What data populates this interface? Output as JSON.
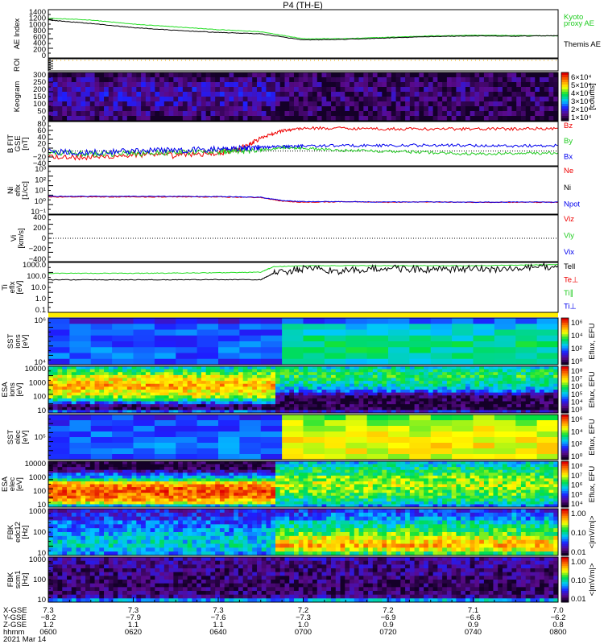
{
  "chart_data": {
    "type": "multi-panel",
    "title": "P4 (TH-E)",
    "x_unit": "minutes after 0600 UT",
    "xlim": [
      0,
      120
    ],
    "panels": [
      {
        "id": "ae",
        "type": "line",
        "ylabel": [
          "AE Index"
        ],
        "ylim": [
          0,
          1400
        ],
        "ticks": [
          "1400",
          "1200",
          "1000",
          "800",
          "600",
          "400",
          "200",
          "0"
        ],
        "legend": [
          {
            "text": "Kyoto",
            "color": "#22cc22"
          },
          {
            "text": "proxy AE",
            "color": "#22cc22"
          },
          {
            "text": "Themis AE",
            "color": "#000000"
          }
        ],
        "series": [
          {
            "name": "Kyoto proxy AE",
            "color": "#22dd22",
            "x": [
              0,
              10,
              20,
              30,
              40,
              50,
              60,
              70,
              80,
              90,
              100,
              110,
              120
            ],
            "y": [
              1150,
              1100,
              980,
              900,
              820,
              760,
              560,
              560,
              600,
              640,
              660,
              650,
              640
            ]
          },
          {
            "name": "Themis AE",
            "color": "#000000",
            "x": [
              0,
              10,
              20,
              30,
              40,
              50,
              60,
              70,
              80,
              90,
              100,
              110,
              120
            ],
            "y": [
              1100,
              1000,
              880,
              800,
              740,
              700,
              520,
              540,
              580,
              620,
              640,
              630,
              650
            ]
          }
        ]
      },
      {
        "id": "roi",
        "type": "line",
        "ylabel": [
          "ROI"
        ],
        "ticks": [],
        "legend": []
      },
      {
        "id": "keo",
        "type": "heatmap",
        "ylabel": [
          "Keogram"
        ],
        "ticks": [
          "300",
          "250",
          "200",
          "150",
          "100",
          "50",
          "0"
        ],
        "colorbar": {
          "labels": [
            "6×10⁴",
            "5×10⁴",
            "4×10⁴",
            "3×10⁴",
            "2×10⁴",
            "1×10⁴"
          ],
          "unit": "[counts]"
        },
        "rows": 10,
        "pre": [
          0.05,
          0.1,
          0.14,
          0.16,
          0.16,
          0.15,
          0.14,
          0.12,
          0.1,
          0.06
        ],
        "post": [
          0.03,
          0.06,
          0.08,
          0.08,
          0.08,
          0.08,
          0.07,
          0.06,
          0.05,
          0.03
        ]
      },
      {
        "id": "b",
        "type": "line",
        "ylabel": [
          "B FIT",
          "GSE",
          "[nT]"
        ],
        "ylim": [
          -40,
          80
        ],
        "ticks": [
          "80",
          "60",
          "40",
          "20",
          "0",
          "−20",
          "−40"
        ],
        "legend": [
          {
            "text": "Bz",
            "color": "#ee0000"
          },
          {
            "text": "By",
            "color": "#22cc22"
          },
          {
            "text": "Bx",
            "color": "#0000ee"
          }
        ],
        "series": [
          {
            "name": "Bz",
            "color": "#ee0000",
            "x": [
              0,
              10,
              20,
              30,
              40,
              45,
              50,
              55,
              60,
              70,
              80,
              90,
              100,
              110,
              120
            ],
            "y": [
              -15,
              -18,
              -10,
              -12,
              -5,
              5,
              35,
              55,
              62,
              62,
              60,
              60,
              60,
              60,
              62
            ]
          },
          {
            "name": "By",
            "color": "#22cc22",
            "x": [
              0,
              10,
              20,
              30,
              40,
              45,
              50,
              55,
              60,
              70,
              80,
              90,
              100,
              110,
              120
            ],
            "y": [
              -5,
              -8,
              -6,
              -3,
              -2,
              0,
              2,
              10,
              8,
              2,
              0,
              -4,
              -8,
              -6,
              -5
            ]
          },
          {
            "name": "Bx",
            "color": "#0000ee",
            "x": [
              0,
              10,
              20,
              30,
              40,
              45,
              50,
              55,
              60,
              70,
              80,
              90,
              100,
              110,
              120
            ],
            "y": [
              -2,
              -3,
              0,
              2,
              5,
              8,
              10,
              12,
              14,
              15,
              15,
              16,
              15,
              14,
              15
            ]
          }
        ]
      },
      {
        "id": "ni",
        "type": "line",
        "ylabel": [
          "Ni",
          "eflx",
          "[1/cc]"
        ],
        "ylim": [
          -1,
          3
        ],
        "log": true,
        "ticks": [
          "10³",
          "10²",
          "10¹",
          "10⁰",
          "10⁻¹"
        ],
        "legend": [
          {
            "text": "Ne",
            "color": "#ee0000"
          },
          {
            "text": "Ni",
            "color": "#000000"
          },
          {
            "text": "Npot",
            "color": "#0000ee"
          }
        ],
        "series": [
          {
            "name": "Ne",
            "color": "#ee0000",
            "x": [
              0,
              10,
              20,
              30,
              40,
              50,
              55,
              60,
              70,
              80,
              90,
              100,
              110,
              120
            ],
            "y": [
              0.45,
              0.45,
              0.45,
              0.45,
              0.45,
              0.4,
              0.1,
              0.0,
              0.05,
              0.0,
              0.02,
              0.0,
              0.0,
              0.0
            ]
          },
          {
            "name": "Npot",
            "color": "#0000ee",
            "x": [
              0,
              10,
              20,
              30,
              40,
              50,
              55,
              60,
              70,
              80,
              90,
              100,
              110,
              120
            ],
            "y": [
              0.5,
              0.5,
              0.5,
              0.5,
              0.48,
              0.42,
              0.15,
              0.05,
              0.05,
              0.02,
              0.03,
              0.0,
              0.02,
              0.02
            ]
          }
        ]
      },
      {
        "id": "vi",
        "type": "line",
        "ylabel": [
          "Vi",
          "[km/s]"
        ],
        "ylim": [
          -500,
          500
        ],
        "ticks": [
          "400",
          "200",
          "0",
          "−200",
          "−400"
        ],
        "legend": [
          {
            "text": "Viz",
            "color": "#ee0000"
          },
          {
            "text": "Viy",
            "color": "#22cc22"
          },
          {
            "text": "Vix",
            "color": "#0000ee"
          }
        ],
        "series": []
      },
      {
        "id": "ti",
        "type": "line",
        "ylabel": [
          "Ti",
          "eflx",
          "[eV]"
        ],
        "ylim": [
          -1,
          3.6
        ],
        "log": true,
        "ticks": [
          "1000.0",
          "100.0",
          "10.0",
          "1.0",
          "0.1"
        ],
        "legend": [
          {
            "text": "Tell",
            "color": "#000000"
          },
          {
            "text": "Te⊥",
            "color": "#ee0000"
          },
          {
            "text": "Ti∥",
            "color": "#22cc22"
          },
          {
            "text": "Ti⊥",
            "color": "#0000ee"
          }
        ],
        "series": [
          {
            "name": "Ti∥",
            "color": "#22dd22",
            "x": [
              0,
              10,
              20,
              30,
              40,
              50,
              53,
              60,
              70,
              80,
              90,
              100,
              110,
              120
            ],
            "y": [
              2.6,
              2.6,
              2.6,
              2.62,
              2.65,
              2.7,
              3.2,
              3.3,
              3.3,
              3.3,
              3.3,
              3.3,
              3.35,
              3.4
            ]
          },
          {
            "name": "Tell",
            "color": "#000000",
            "x": [
              0,
              10,
              20,
              30,
              40,
              50,
              53,
              60,
              70,
              80,
              90,
              100,
              110,
              120
            ],
            "y": [
              2.0,
              2.0,
              2.0,
              2.0,
              2.02,
              2.0,
              2.6,
              3.0,
              2.8,
              3.1,
              2.9,
              3.0,
              3.0,
              3.3
            ]
          }
        ]
      },
      {
        "id": "ssti",
        "type": "heatmap",
        "ylabel": [
          "SST",
          "ions",
          "[eV]"
        ],
        "ticks": [
          "10⁶",
          "10⁴"
        ],
        "colorbar": {
          "labels": [
            "10⁶",
            "10⁴",
            "10²",
            "10⁰"
          ],
          "unit": "Eflux, EFU"
        },
        "rows": 8,
        "pre": [
          0.22,
          0.3,
          0.3,
          0.28,
          0.3,
          0.32,
          0.3,
          0.28
        ],
        "post": [
          0.3,
          0.42,
          0.45,
          0.48,
          0.5,
          0.5,
          0.48,
          0.45
        ]
      },
      {
        "id": "esai",
        "type": "heatmap",
        "ylabel": [
          "ESA",
          "ions",
          "[eV]"
        ],
        "ticks": [
          "10000",
          "1000",
          "100",
          "10"
        ],
        "colorbar": {
          "labels": [
            "10⁸",
            "10⁷",
            "10⁶",
            "10⁵",
            "10⁴",
            "10³"
          ],
          "unit": "Eflux, EFU"
        },
        "rows": 16,
        "pre": [
          0.45,
          0.55,
          0.6,
          0.68,
          0.72,
          0.75,
          0.8,
          0.78,
          0.72,
          0.7,
          0.65,
          0.5,
          0.3,
          0.1,
          0.05,
          0.3
        ],
        "post": [
          0.45,
          0.5,
          0.52,
          0.55,
          0.52,
          0.5,
          0.45,
          0.4,
          0.3,
          0.15,
          0.06,
          0.04,
          0.03,
          0.03,
          0.03,
          0.2
        ]
      },
      {
        "id": "sste",
        "type": "heatmap",
        "ylabel": [
          "SST",
          "elec",
          "[eV]"
        ],
        "ticks": [
          "10⁵"
        ],
        "colorbar": {
          "labels": [
            "10⁶",
            "10⁴",
            "10²",
            "10⁰"
          ],
          "unit": "Eflux, EFU"
        },
        "rows": 8,
        "pre": [
          0.25,
          0.28,
          0.3,
          0.3,
          0.32,
          0.33,
          0.32,
          0.3
        ],
        "post": [
          0.6,
          0.65,
          0.68,
          0.7,
          0.72,
          0.72,
          0.7,
          0.68
        ]
      },
      {
        "id": "esae",
        "type": "heatmap",
        "ylabel": [
          "ESA",
          "elec",
          "[eV]"
        ],
        "ticks": [
          "10000",
          "1000",
          "100",
          "10"
        ],
        "colorbar": {
          "labels": [
            "10⁸",
            "10⁷",
            "10⁶",
            "10⁵",
            "10⁴"
          ],
          "unit": "Eflux, EFU"
        },
        "rows": 16,
        "pre": [
          0.02,
          0.03,
          0.05,
          0.15,
          0.3,
          0.38,
          0.5,
          0.75,
          0.85,
          0.88,
          0.9,
          0.88,
          0.85,
          0.8,
          0.7,
          0.4
        ],
        "post": [
          0.4,
          0.45,
          0.5,
          0.52,
          0.55,
          0.6,
          0.62,
          0.65,
          0.65,
          0.62,
          0.6,
          0.58,
          0.55,
          0.5,
          0.45,
          0.35
        ]
      },
      {
        "id": "fbk1",
        "type": "heatmap",
        "ylabel": [
          "FBK",
          "edc12",
          "[Hz]"
        ],
        "ticks": [
          "1000",
          "100",
          "10"
        ],
        "colorbar": {
          "labels": [
            "1.00",
            "0.10",
            "0.01"
          ],
          "unit": "<|mV/m|>"
        },
        "rows": 12,
        "pre": [
          0.2,
          0.22,
          0.25,
          0.3,
          0.32,
          0.35,
          0.38,
          0.4,
          0.42,
          0.45,
          0.4,
          0.35
        ],
        "post": [
          0.25,
          0.3,
          0.35,
          0.45,
          0.5,
          0.55,
          0.6,
          0.7,
          0.75,
          0.8,
          0.7,
          0.55
        ]
      },
      {
        "id": "fbk2",
        "type": "heatmap",
        "ylabel": [
          "FBK",
          "scm1",
          "[Hz]"
        ],
        "ticks": [
          "1000",
          "100",
          "10"
        ],
        "colorbar": {
          "labels": [
            "1.00",
            "0.10",
            "0.01"
          ],
          "unit": "<|mV/m|>"
        },
        "rows": 12,
        "pre": [
          0.14,
          0.12,
          0.12,
          0.1,
          0.1,
          0.08,
          0.08,
          0.06,
          0.06,
          0.08,
          0.12,
          0.35
        ],
        "post": [
          0.14,
          0.12,
          0.12,
          0.1,
          0.1,
          0.08,
          0.08,
          0.06,
          0.06,
          0.08,
          0.12,
          0.38
        ]
      }
    ],
    "x_axis": {
      "rows": [
        {
          "label": "X-GSE",
          "values": [
            "7.3",
            "7.3",
            "7.3",
            "7.2",
            "7.2",
            "7.1",
            "7.0"
          ]
        },
        {
          "label": "Y-GSE",
          "values": [
            "−8.2",
            "−7.9",
            "−7.6",
            "−7.3",
            "−6.9",
            "−6.6",
            "−6.2"
          ]
        },
        {
          "label": "Z-GSE",
          "values": [
            "1.2",
            "1.1",
            "1.1",
            "1.0",
            "0.9",
            "0.9",
            "0.8"
          ]
        },
        {
          "label": "hhmm",
          "values": [
            "0600",
            "0620",
            "0640",
            "0700",
            "0720",
            "0740",
            "0800"
          ]
        }
      ],
      "date": "2021 Mar 14"
    }
  }
}
